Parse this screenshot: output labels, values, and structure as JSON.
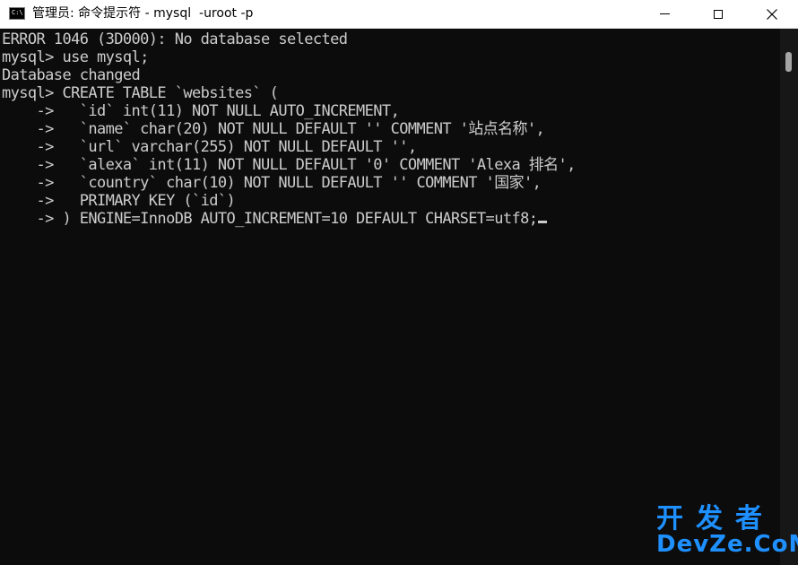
{
  "window": {
    "title": "管理员: 命令提示符 - mysql  -uroot -p",
    "icon_label": "C:\\"
  },
  "terminal": {
    "lines": [
      "ERROR 1046 (3D000): No database selected",
      "mysql> use mysql;",
      "Database changed",
      "mysql> CREATE TABLE `websites` (",
      "    ->   `id` int(11) NOT NULL AUTO_INCREMENT,",
      "    ->   `name` char(20) NOT NULL DEFAULT '' COMMENT '站点名称',",
      "    ->   `url` varchar(255) NOT NULL DEFAULT '',",
      "    ->   `alexa` int(11) NOT NULL DEFAULT '0' COMMENT 'Alexa 排名',",
      "    ->   `country` char(10) NOT NULL DEFAULT '' COMMENT '国家',",
      "    ->   PRIMARY KEY (`id`)",
      "    -> ) ENGINE=InnoDB AUTO_INCREMENT=10 DEFAULT CHARSET=utf8;"
    ]
  },
  "watermark": {
    "top": "开发者",
    "bottom": "DevZe.CoM"
  },
  "colors": {
    "terminal_bg": "#0c0c0c",
    "terminal_text": "#cccccc",
    "titlebar_bg": "#ffffff",
    "watermark": "#1e90ff"
  },
  "icons": {
    "minimize": "minimize-icon",
    "maximize": "maximize-icon",
    "close": "close-icon"
  }
}
